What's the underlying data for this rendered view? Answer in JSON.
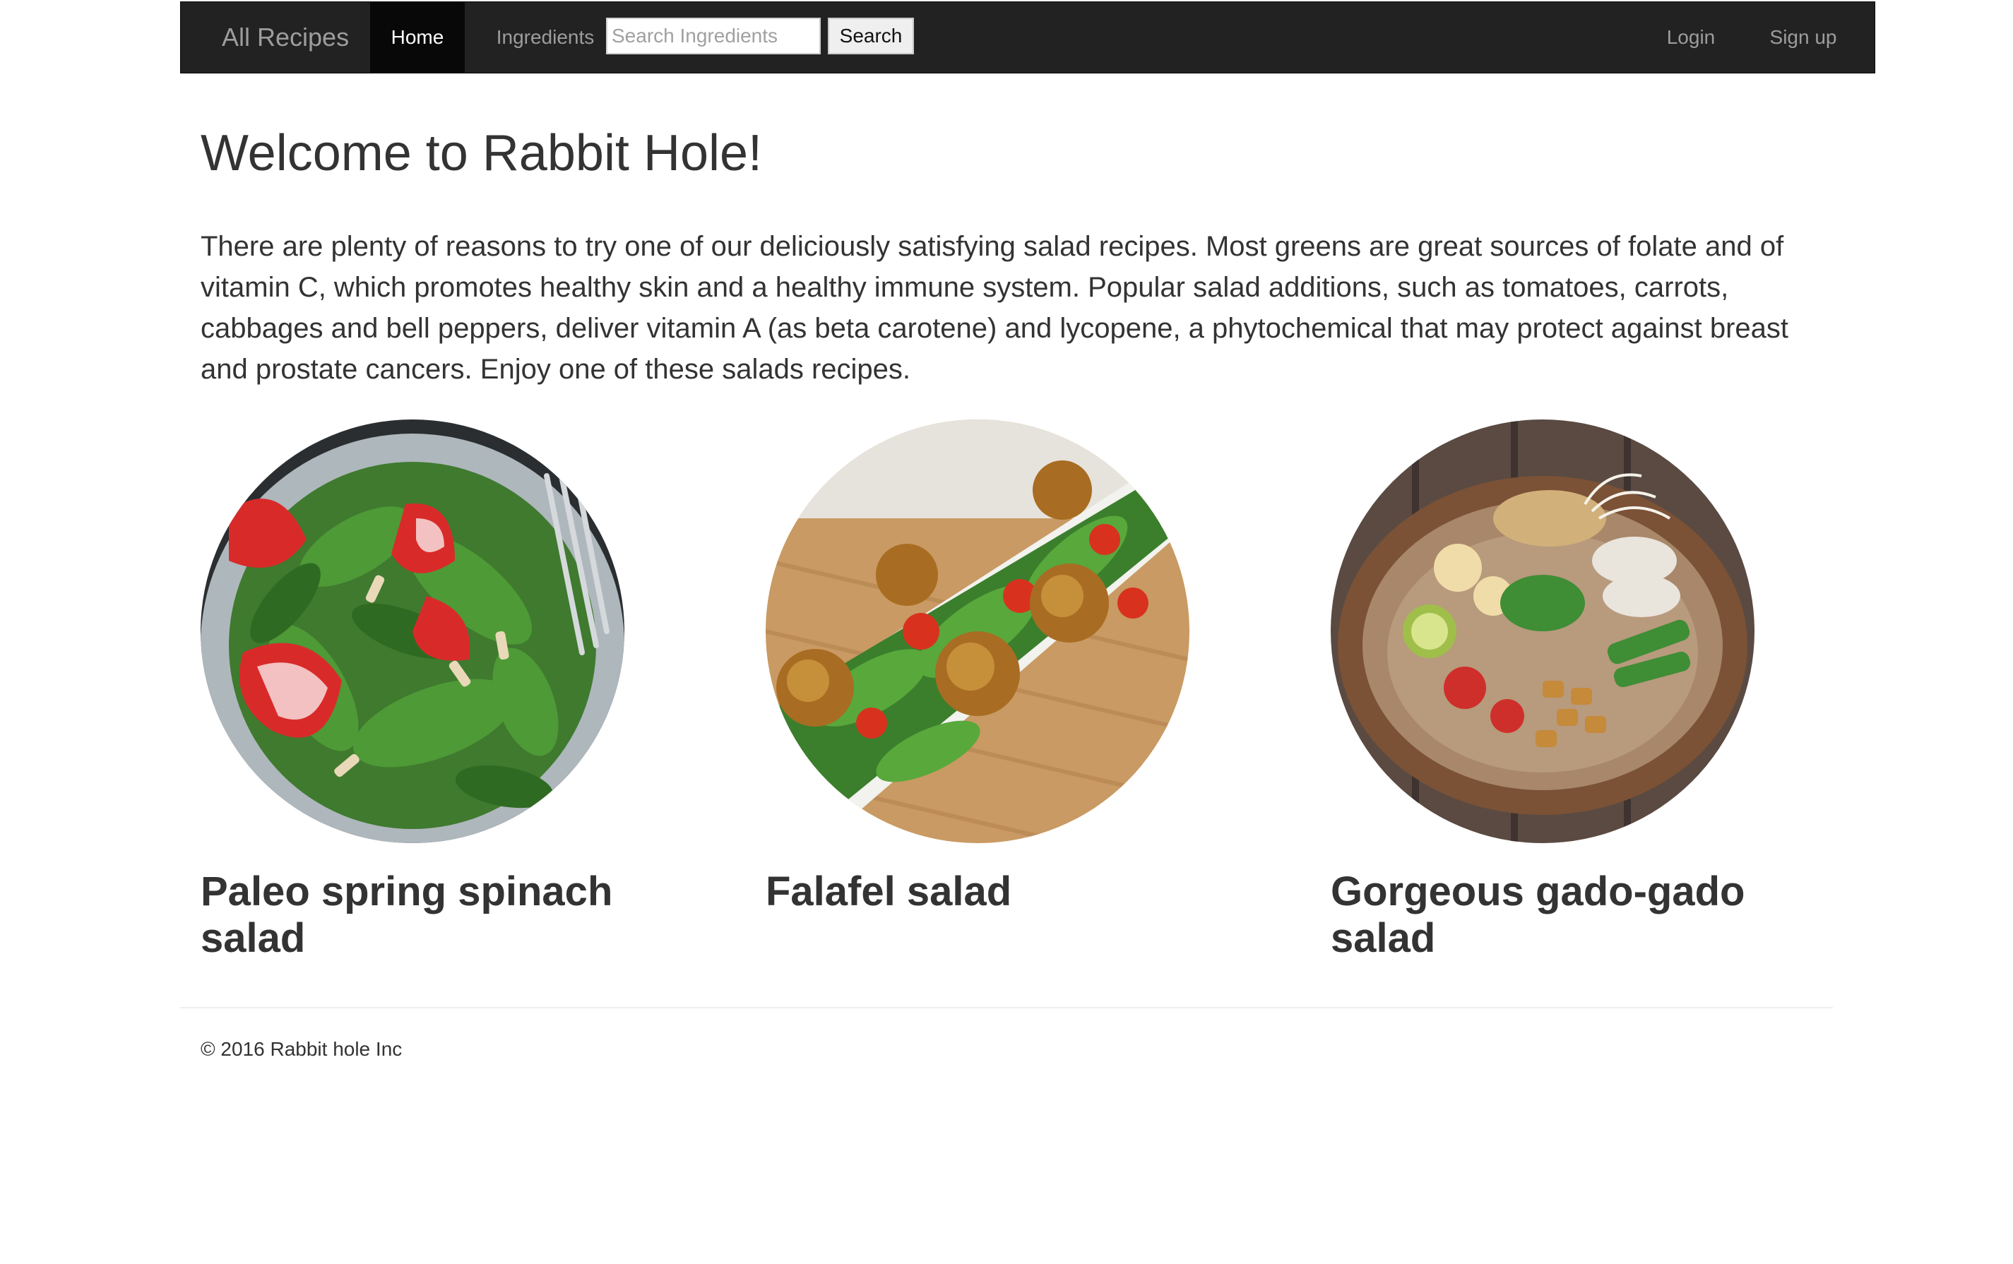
{
  "navbar": {
    "brand": "All Recipes",
    "links": [
      {
        "label": "Home",
        "active": true
      },
      {
        "label": "Ingredients",
        "active": false
      }
    ],
    "search": {
      "placeholder": "Search Ingredients",
      "value": "",
      "button": "Search"
    },
    "right_links": [
      {
        "label": "Login"
      },
      {
        "label": "Sign up"
      }
    ],
    "colors": {
      "background": "#222222",
      "active_background": "#080808",
      "link": "#9d9d9d",
      "active_link": "#ffffff"
    }
  },
  "main": {
    "title": "Welcome to Rabbit Hole!",
    "intro": "There are plenty of reasons to try one of our deliciously satisfying salad recipes. Most greens are great sources of folate and of vitamin C, which promotes healthy skin and a healthy immune system. Popular salad additions, such as tomatoes, carrots, cabbages and bell peppers, deliver vitamin A (as beta carotene) and lycopene, a phytochemical that may protect against breast and prostate cancers. Enjoy one of these salads recipes.",
    "recipes": [
      {
        "title": "Paleo spring spinach salad",
        "image": "spinach-strawberry-salad-photo"
      },
      {
        "title": "Falafel salad",
        "image": "falafel-salad-photo"
      },
      {
        "title": "Gorgeous gado-gado salad",
        "image": "gado-gado-bowl-photo"
      }
    ]
  },
  "footer": {
    "copyright": "© 2016 Rabbit hole Inc"
  }
}
